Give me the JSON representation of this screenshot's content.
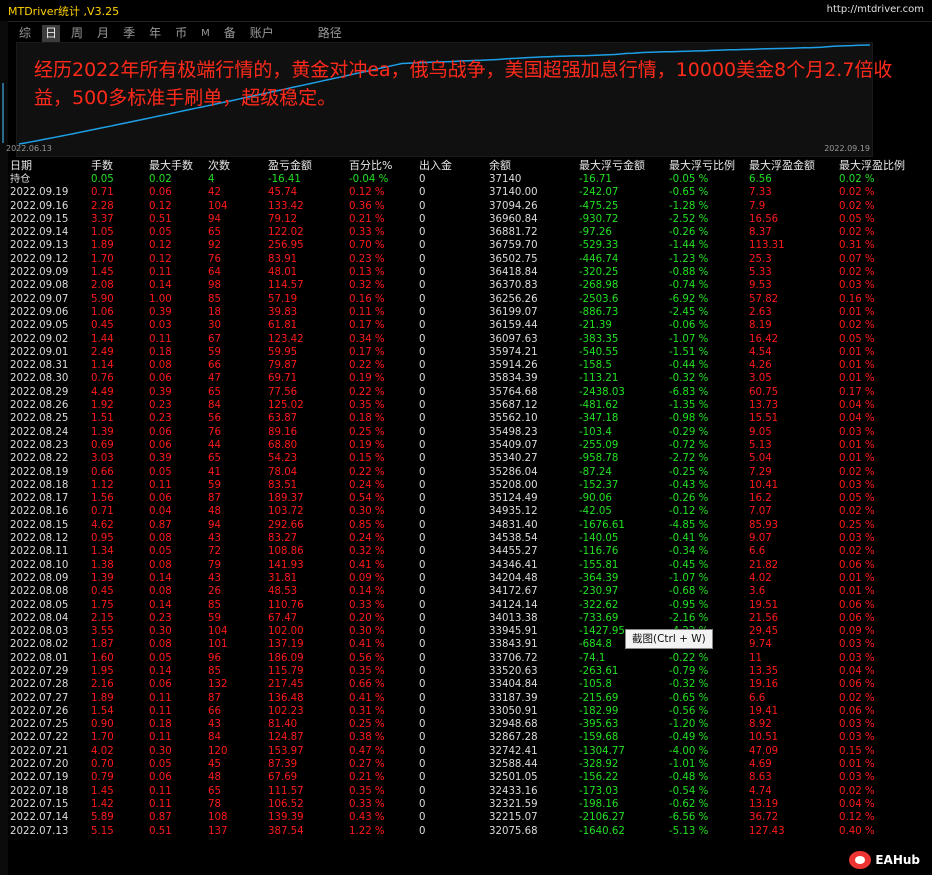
{
  "window": {
    "title": "MTDriver统计 ,V3.25",
    "url": "http://mtdriver.com"
  },
  "tabs": [
    "综",
    "日",
    "周",
    "月",
    "季",
    "年",
    "币",
    "M",
    "备",
    "账户",
    "路径"
  ],
  "active_tab": "日",
  "banner": "经历2022年所有极端行情的，黄金对冲ea，俄乌战争，美国超强加息行情，10000美金8个月2.7倍收益，500多标准手刷单，超级稳定。",
  "chart": {
    "start_date": "2022.06.13",
    "end_date": "2022.09.19",
    "line_color": "#1e9fe6"
  },
  "columns": [
    "日期",
    "手数",
    "最大手数",
    "次数",
    "盈亏金额",
    "百分比%",
    "出入金",
    "余额",
    "最大浮亏金额",
    "最大浮亏比例",
    "最大浮盈金额",
    "最大浮盈比例"
  ],
  "position_row": [
    "持仓",
    "0.05",
    "0.02",
    "4",
    "-16.41",
    "-0.04 %",
    "0",
    "37140",
    "-16.71",
    "-0.05 %",
    "6.56",
    "0.02 %"
  ],
  "rows": [
    [
      "2022.09.19",
      "0.71",
      "0.06",
      "42",
      "45.74",
      "0.12 %",
      "0",
      "37140.00",
      "-242.07",
      "-0.65 %",
      "7.33",
      "0.02 %"
    ],
    [
      "2022.09.16",
      "2.28",
      "0.12",
      "104",
      "133.42",
      "0.36 %",
      "0",
      "37094.26",
      "-475.25",
      "-1.28 %",
      "7.9",
      "0.02 %"
    ],
    [
      "2022.09.15",
      "3.37",
      "0.51",
      "94",
      "79.12",
      "0.21 %",
      "0",
      "36960.84",
      "-930.72",
      "-2.52 %",
      "16.56",
      "0.05 %"
    ],
    [
      "2022.09.14",
      "1.05",
      "0.05",
      "65",
      "122.02",
      "0.33 %",
      "0",
      "36881.72",
      "-97.26",
      "-0.26 %",
      "8.37",
      "0.02 %"
    ],
    [
      "2022.09.13",
      "1.89",
      "0.12",
      "92",
      "256.95",
      "0.70 %",
      "0",
      "36759.70",
      "-529.33",
      "-1.44 %",
      "113.31",
      "0.31 %"
    ],
    [
      "2022.09.12",
      "1.70",
      "0.12",
      "76",
      "83.91",
      "0.23 %",
      "0",
      "36502.75",
      "-446.74",
      "-1.23 %",
      "25.3",
      "0.07 %"
    ],
    [
      "2022.09.09",
      "1.45",
      "0.11",
      "64",
      "48.01",
      "0.13 %",
      "0",
      "36418.84",
      "-320.25",
      "-0.88 %",
      "5.33",
      "0.02 %"
    ],
    [
      "2022.09.08",
      "2.08",
      "0.14",
      "98",
      "114.57",
      "0.32 %",
      "0",
      "36370.83",
      "-268.98",
      "-0.74 %",
      "9.53",
      "0.03 %"
    ],
    [
      "2022.09.07",
      "5.90",
      "1.00",
      "85",
      "57.19",
      "0.16 %",
      "0",
      "36256.26",
      "-2503.6",
      "-6.92 %",
      "57.82",
      "0.16 %"
    ],
    [
      "2022.09.06",
      "1.06",
      "0.39",
      "18",
      "39.83",
      "0.11 %",
      "0",
      "36199.07",
      "-886.73",
      "-2.45 %",
      "2.63",
      "0.01 %"
    ],
    [
      "2022.09.05",
      "0.45",
      "0.03",
      "30",
      "61.81",
      "0.17 %",
      "0",
      "36159.44",
      "-21.39",
      "-0.06 %",
      "8.19",
      "0.02 %"
    ],
    [
      "2022.09.02",
      "1.44",
      "0.11",
      "67",
      "123.42",
      "0.34 %",
      "0",
      "36097.63",
      "-383.35",
      "-1.07 %",
      "16.42",
      "0.05 %"
    ],
    [
      "2022.09.01",
      "2.49",
      "0.18",
      "59",
      "59.95",
      "0.17 %",
      "0",
      "35974.21",
      "-540.55",
      "-1.51 %",
      "4.54",
      "0.01 %"
    ],
    [
      "2022.08.31",
      "1.14",
      "0.08",
      "66",
      "79.87",
      "0.22 %",
      "0",
      "35914.26",
      "-158.5",
      "-0.44 %",
      "4.26",
      "0.01 %"
    ],
    [
      "2022.08.30",
      "0.76",
      "0.06",
      "47",
      "69.71",
      "0.19 %",
      "0",
      "35834.39",
      "-113.21",
      "-0.32 %",
      "3.05",
      "0.01 %"
    ],
    [
      "2022.08.29",
      "4.49",
      "0.39",
      "65",
      "77.56",
      "0.22 %",
      "0",
      "35764.68",
      "-2438.03",
      "-6.83 %",
      "60.75",
      "0.17 %"
    ],
    [
      "2022.08.26",
      "1.92",
      "0.23",
      "84",
      "125.02",
      "0.35 %",
      "0",
      "35687.12",
      "-481.62",
      "-1.35 %",
      "13.73",
      "0.04 %"
    ],
    [
      "2022.08.25",
      "1.51",
      "0.23",
      "56",
      "63.87",
      "0.18 %",
      "0",
      "35562.10",
      "-347.18",
      "-0.98 %",
      "15.51",
      "0.04 %"
    ],
    [
      "2022.08.24",
      "1.39",
      "0.06",
      "76",
      "89.16",
      "0.25 %",
      "0",
      "35498.23",
      "-103.4",
      "-0.29 %",
      "9.05",
      "0.03 %"
    ],
    [
      "2022.08.23",
      "0.69",
      "0.06",
      "44",
      "68.80",
      "0.19 %",
      "0",
      "35409.07",
      "-255.09",
      "-0.72 %",
      "5.13",
      "0.01 %"
    ],
    [
      "2022.08.22",
      "3.03",
      "0.39",
      "65",
      "54.23",
      "0.15 %",
      "0",
      "35340.27",
      "-958.78",
      "-2.72 %",
      "5.04",
      "0.01 %"
    ],
    [
      "2022.08.19",
      "0.66",
      "0.05",
      "41",
      "78.04",
      "0.22 %",
      "0",
      "35286.04",
      "-87.24",
      "-0.25 %",
      "7.29",
      "0.02 %"
    ],
    [
      "2022.08.18",
      "1.12",
      "0.11",
      "59",
      "83.51",
      "0.24 %",
      "0",
      "35208.00",
      "-152.37",
      "-0.43 %",
      "10.41",
      "0.03 %"
    ],
    [
      "2022.08.17",
      "1.56",
      "0.06",
      "87",
      "189.37",
      "0.54 %",
      "0",
      "35124.49",
      "-90.06",
      "-0.26 %",
      "16.2",
      "0.05 %"
    ],
    [
      "2022.08.16",
      "0.71",
      "0.04",
      "48",
      "103.72",
      "0.30 %",
      "0",
      "34935.12",
      "-42.05",
      "-0.12 %",
      "7.07",
      "0.02 %"
    ],
    [
      "2022.08.15",
      "4.62",
      "0.87",
      "94",
      "292.66",
      "0.85 %",
      "0",
      "34831.40",
      "-1676.61",
      "-4.85 %",
      "85.93",
      "0.25 %"
    ],
    [
      "2022.08.12",
      "0.95",
      "0.08",
      "43",
      "83.27",
      "0.24 %",
      "0",
      "34538.54",
      "-140.05",
      "-0.41 %",
      "9.07",
      "0.03 %"
    ],
    [
      "2022.08.11",
      "1.34",
      "0.05",
      "72",
      "108.86",
      "0.32 %",
      "0",
      "34455.27",
      "-116.76",
      "-0.34 %",
      "6.6",
      "0.02 %"
    ],
    [
      "2022.08.10",
      "1.38",
      "0.08",
      "79",
      "141.93",
      "0.41 %",
      "0",
      "34346.41",
      "-155.81",
      "-0.45 %",
      "21.82",
      "0.06 %"
    ],
    [
      "2022.08.09",
      "1.39",
      "0.14",
      "43",
      "31.81",
      "0.09 %",
      "0",
      "34204.48",
      "-364.39",
      "-1.07 %",
      "4.02",
      "0.01 %"
    ],
    [
      "2022.08.08",
      "0.45",
      "0.08",
      "26",
      "48.53",
      "0.14 %",
      "0",
      "34172.67",
      "-230.97",
      "-0.68 %",
      "3.6",
      "0.01 %"
    ],
    [
      "2022.08.05",
      "1.75",
      "0.14",
      "85",
      "110.76",
      "0.33 %",
      "0",
      "34124.14",
      "-322.62",
      "-0.95 %",
      "19.51",
      "0.06 %"
    ],
    [
      "2022.08.04",
      "2.15",
      "0.23",
      "59",
      "67.47",
      "0.20 %",
      "0",
      "34013.38",
      "-733.69",
      "-2.16 %",
      "21.56",
      "0.06 %"
    ],
    [
      "2022.08.03",
      "3.55",
      "0.30",
      "104",
      "102.00",
      "0.30 %",
      "0",
      "33945.91",
      "-1427.95",
      "-4.22 %",
      "29.45",
      "0.09 %"
    ],
    [
      "2022.08.02",
      "1.87",
      "0.08",
      "101",
      "137.19",
      "0.41 %",
      "0",
      "33843.91",
      "-684.8",
      "-2.02 %",
      "9.74",
      "0.03 %"
    ],
    [
      "2022.08.01",
      "1.60",
      "0.05",
      "96",
      "186.09",
      "0.56 %",
      "0",
      "33706.72",
      "-74.1",
      "-0.22 %",
      "11",
      "0.03 %"
    ],
    [
      "2022.07.29",
      "1.95",
      "0.14",
      "85",
      "115.79",
      "0.35 %",
      "0",
      "33520.63",
      "-263.61",
      "-0.79 %",
      "13.35",
      "0.04 %"
    ],
    [
      "2022.07.28",
      "2.16",
      "0.06",
      "132",
      "217.45",
      "0.66 %",
      "0",
      "33404.84",
      "-105.8",
      "-0.32 %",
      "19.16",
      "0.06 %"
    ],
    [
      "2022.07.27",
      "1.89",
      "0.11",
      "87",
      "136.48",
      "0.41 %",
      "0",
      "33187.39",
      "-215.69",
      "-0.65 %",
      "6.6",
      "0.02 %"
    ],
    [
      "2022.07.26",
      "1.54",
      "0.11",
      "66",
      "102.23",
      "0.31 %",
      "0",
      "33050.91",
      "-182.99",
      "-0.56 %",
      "19.41",
      "0.06 %"
    ],
    [
      "2022.07.25",
      "0.90",
      "0.18",
      "43",
      "81.40",
      "0.25 %",
      "0",
      "32948.68",
      "-395.63",
      "-1.20 %",
      "8.92",
      "0.03 %"
    ],
    [
      "2022.07.22",
      "1.70",
      "0.11",
      "84",
      "124.87",
      "0.38 %",
      "0",
      "32867.28",
      "-159.68",
      "-0.49 %",
      "10.51",
      "0.03 %"
    ],
    [
      "2022.07.21",
      "4.02",
      "0.30",
      "120",
      "153.97",
      "0.47 %",
      "0",
      "32742.41",
      "-1304.77",
      "-4.00 %",
      "47.09",
      "0.15 %"
    ],
    [
      "2022.07.20",
      "0.70",
      "0.05",
      "45",
      "87.39",
      "0.27 %",
      "0",
      "32588.44",
      "-328.92",
      "-1.01 %",
      "4.69",
      "0.01 %"
    ],
    [
      "2022.07.19",
      "0.79",
      "0.06",
      "48",
      "67.69",
      "0.21 %",
      "0",
      "32501.05",
      "-156.22",
      "-0.48 %",
      "8.63",
      "0.03 %"
    ],
    [
      "2022.07.18",
      "1.45",
      "0.11",
      "65",
      "111.57",
      "0.35 %",
      "0",
      "32433.16",
      "-173.03",
      "-0.54 %",
      "4.74",
      "0.02 %"
    ],
    [
      "2022.07.15",
      "1.42",
      "0.11",
      "78",
      "106.52",
      "0.33 %",
      "0",
      "32321.59",
      "-198.16",
      "-0.62 %",
      "13.19",
      "0.04 %"
    ],
    [
      "2022.07.14",
      "5.89",
      "0.87",
      "108",
      "139.39",
      "0.43 %",
      "0",
      "32215.07",
      "-2106.27",
      "-6.56 %",
      "36.72",
      "0.12 %"
    ],
    [
      "2022.07.13",
      "5.15",
      "0.51",
      "137",
      "387.54",
      "1.22 %",
      "0",
      "32075.68",
      "-1640.62",
      "-5.13 %",
      "127.43",
      "0.40 %"
    ]
  ],
  "tooltip": "截图(Ctrl + W)",
  "watermark": "EAHub"
}
